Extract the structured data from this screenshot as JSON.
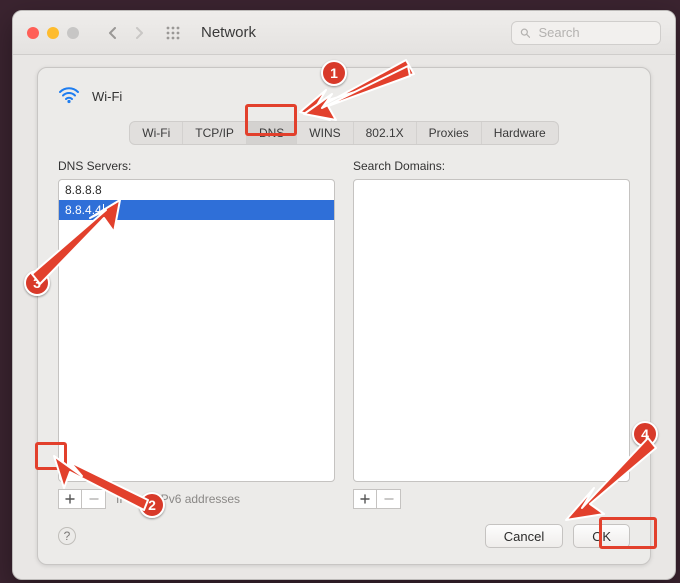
{
  "window": {
    "title": "Network",
    "search_placeholder": "Search"
  },
  "sheet": {
    "icon": "wifi-icon",
    "title": "Wi-Fi",
    "tabs": [
      "Wi-Fi",
      "TCP/IP",
      "DNS",
      "WINS",
      "802.1X",
      "Proxies",
      "Hardware"
    ],
    "active_tab_index": 2,
    "dns": {
      "label": "DNS Servers:",
      "rows": [
        "8.8.8.8",
        "8.8.4.4"
      ],
      "selected_index": 1,
      "hint": "IPv4 or IPv6 addresses"
    },
    "search_domains": {
      "label": "Search Domains:",
      "rows": []
    },
    "buttons": {
      "cancel": "Cancel",
      "ok": "OK",
      "help": "?"
    }
  },
  "annotations": {
    "badges": {
      "b1": "1",
      "b2": "2",
      "b3": "3",
      "b4": "4"
    }
  }
}
